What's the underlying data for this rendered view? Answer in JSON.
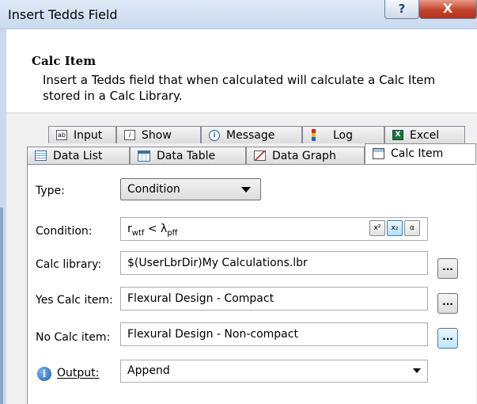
{
  "window": {
    "title": "Insert Tedds Field",
    "help_label": "?",
    "close_label": "X"
  },
  "header": {
    "title": "Calc Item",
    "description": "Insert a Tedds field that when calculated will calculate a Calc Item stored in a Calc Library."
  },
  "tabs_row1": [
    {
      "label": "Input",
      "icon": "text-field-icon",
      "glyph": "ab"
    },
    {
      "label": "Show",
      "icon": "show-icon",
      "glyph": "i"
    },
    {
      "label": "Message",
      "icon": "info-icon",
      "glyph": "i"
    },
    {
      "label": "Log",
      "icon": "log-icon",
      "glyph": ""
    },
    {
      "label": "Excel",
      "icon": "excel-icon",
      "glyph": "X"
    }
  ],
  "tabs_row2": [
    {
      "label": "Data List",
      "icon": "data-list-icon"
    },
    {
      "label": "Data Table",
      "icon": "data-table-icon"
    },
    {
      "label": "Data Graph",
      "icon": "data-graph-icon"
    },
    {
      "label": "Calc Item",
      "icon": "calc-item-icon",
      "active": true
    }
  ],
  "form": {
    "type_label": "Type:",
    "type_value": "Condition",
    "condition_label": "Condition:",
    "condition_value": {
      "r": "r",
      "r_sub": "wtf",
      "op": " < ",
      "lambda": "λ",
      "lambda_sub": "pff"
    },
    "format_buttons": {
      "superscript": "x²",
      "subscript": "x₂",
      "symbol": "α"
    },
    "calc_library_label": "Calc library:",
    "calc_library_value": "$(UserLbrDir)My Calculations.lbr",
    "yes_label": "Yes Calc item:",
    "yes_value": "Flexural Design - Compact",
    "no_label": "No Calc item:",
    "no_value": "Flexural Design - Non-compact",
    "output_label": "Output:",
    "output_value": "Append",
    "browse_label": "..."
  },
  "colors": {
    "titlebar": "#c9daee",
    "close_button": "#c4442b",
    "info_icon": "#1a5fb4",
    "excel_icon": "#1e7145",
    "active_browse": "#bee6fd"
  }
}
